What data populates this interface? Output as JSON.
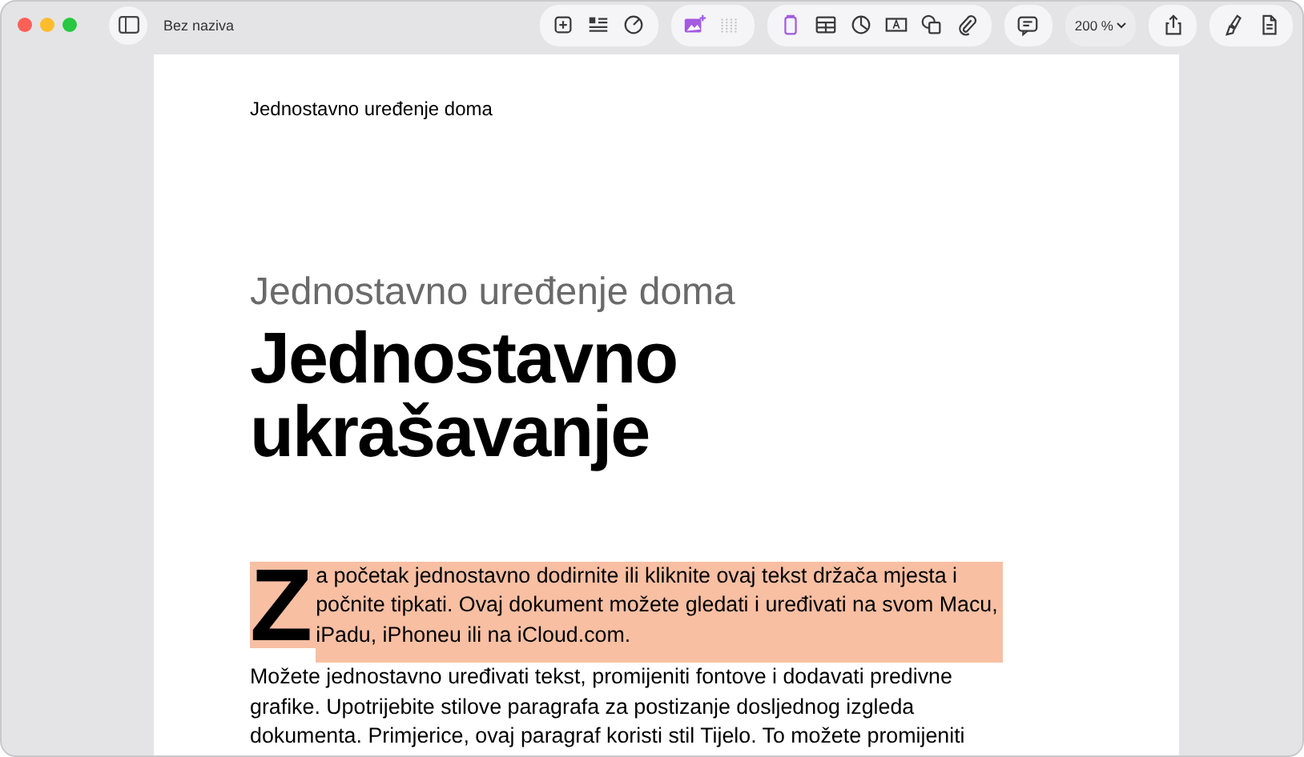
{
  "window": {
    "title": "Bez naziva"
  },
  "toolbar": {
    "groups": [
      {
        "buttons": [
          {
            "selected": false,
            "disabled": false
          },
          {
            "selected": false,
            "disabled": false
          },
          {
            "selected": false,
            "disabled": false
          }
        ]
      },
      {
        "buttons": [
          {
            "selected": true,
            "disabled": false
          },
          {
            "selected": false,
            "disabled": true
          }
        ]
      },
      {
        "buttons": [
          {
            "selected": true,
            "disabled": false
          },
          {
            "selected": false,
            "disabled": false
          },
          {
            "selected": false,
            "disabled": false
          },
          {
            "selected": false,
            "disabled": false
          },
          {
            "selected": false,
            "disabled": false
          },
          {
            "selected": false,
            "disabled": false
          }
        ]
      },
      {
        "buttons": [
          {
            "selected": false,
            "disabled": false
          }
        ]
      }
    ],
    "zoom": "200 %",
    "end_groups": [
      {
        "buttons": [
          {
            "selected": false,
            "disabled": false
          }
        ]
      },
      {
        "buttons": [
          {
            "selected": false,
            "disabled": false
          },
          {
            "selected": false,
            "disabled": false
          }
        ]
      }
    ]
  },
  "document": {
    "header": "Jednostavno uređenje doma",
    "subtitle": "Jednostavno uređenje doma",
    "title": "Jednostavno ukrašavanje",
    "paragraphs": [
      {
        "drop_cap": "Z",
        "text": "a početak jednostavno dodirnite ili kliknite ovaj tekst držača mjesta i počnite tipkati. Ovaj dokument možete gledati i uređivati na svom Macu, iPadu, iPhoneu ili na iCloud.com.",
        "highlighted": true
      },
      {
        "text": "Možete jednostavno uređivati tekst, promijeniti fontove i dodavati predivne grafike. Upotrijebite stilove paragrafa za postizanje dosljednog izgleda dokumenta. Primjerice, ovaj paragraf koristi stil Tijelo. To možete promijeniti",
        "highlighted": false
      }
    ]
  }
}
